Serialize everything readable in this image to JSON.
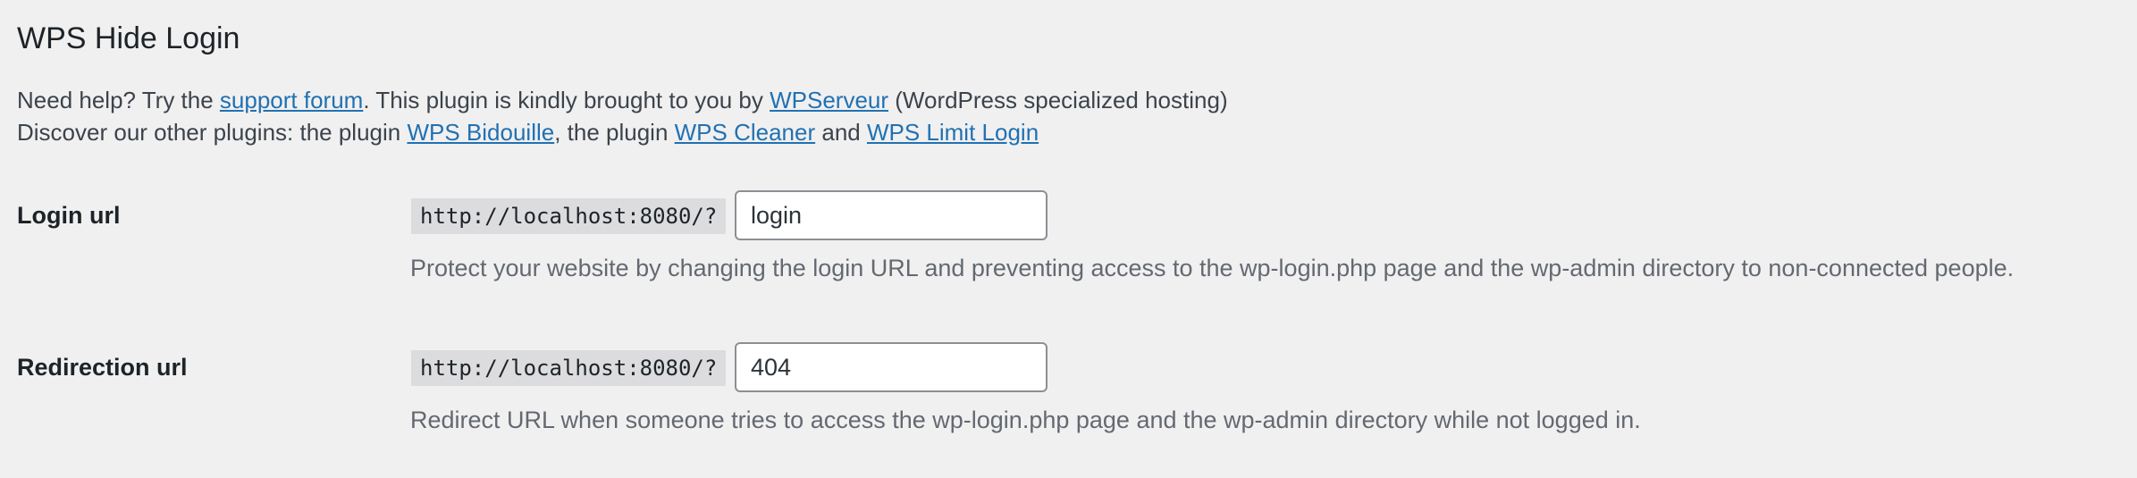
{
  "page": {
    "title": "WPS Hide Login"
  },
  "intro": {
    "line1_prefix": "Need help? Try the ",
    "support_link": "support forum",
    "line1_middle": ". This plugin is kindly brought to you by ",
    "wpserveur_link": "WPServeur",
    "line1_suffix": " (WordPress specialized hosting)",
    "line2_prefix": "Discover our other plugins: the plugin ",
    "bidouille_link": "WPS Bidouille",
    "line2_middle": ", the plugin ",
    "cleaner_link": "WPS Cleaner",
    "line2_and": " and ",
    "limit_login_link": "WPS Limit Login"
  },
  "fields": {
    "login": {
      "label": "Login url",
      "prefix": "http://localhost:8080/?",
      "value": "login",
      "description": "Protect your website by changing the login URL and preventing access to the wp-login.php page and the wp-admin directory to non-connected people."
    },
    "redirection": {
      "label": "Redirection url",
      "prefix": "http://localhost:8080/?",
      "value": "404",
      "description": "Redirect URL when someone tries to access the wp-login.php page and the wp-admin directory while not logged in."
    }
  },
  "colors": {
    "background": "#f0f0f1",
    "link": "#2271b1",
    "text": "#1d2327",
    "muted": "#646970"
  }
}
